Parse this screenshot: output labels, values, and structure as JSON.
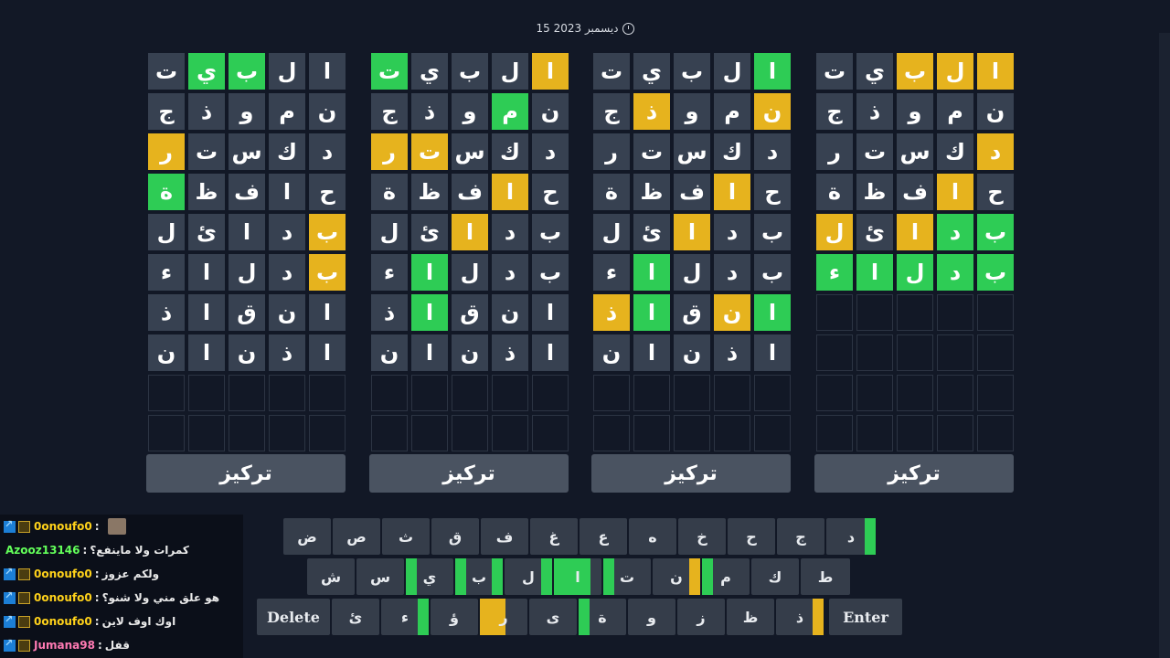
{
  "date_label": "15 ديسمبر 2023",
  "focus_label": "تركيز",
  "colors": {
    "green": "#2ecc55",
    "yellow": "#e6b31e",
    "tile": "#374151",
    "background": "#121826"
  },
  "boards": [
    {
      "rows": [
        [
          "ا",
          "ل",
          "ب",
          "ي",
          "ت"
        ],
        [
          "ن",
          "م",
          "و",
          "ذ",
          "ج"
        ],
        [
          "د",
          "ك",
          "س",
          "ت",
          "ر"
        ],
        [
          "ح",
          "ا",
          "ف",
          "ظ",
          "ة"
        ],
        [
          "ب",
          "د",
          "ا",
          "ئ",
          "ل"
        ],
        [
          "ب",
          "د",
          "ل",
          "ا",
          "ء"
        ],
        [
          "ا",
          "ن",
          "ق",
          "ا",
          "ذ"
        ],
        [
          "ا",
          "ذ",
          "ن",
          "ا",
          "ن"
        ],
        [
          "",
          "",
          "",
          "",
          ""
        ],
        [
          "",
          "",
          "",
          "",
          ""
        ]
      ],
      "states": [
        [
          "x",
          "x",
          "g",
          "g",
          "x"
        ],
        [
          "x",
          "x",
          "x",
          "x",
          "x"
        ],
        [
          "x",
          "x",
          "x",
          "x",
          "y"
        ],
        [
          "x",
          "x",
          "x",
          "x",
          "g"
        ],
        [
          "y",
          "x",
          "x",
          "x",
          "x"
        ],
        [
          "y",
          "x",
          "x",
          "x",
          "x"
        ],
        [
          "x",
          "x",
          "x",
          "x",
          "x"
        ],
        [
          "x",
          "x",
          "x",
          "x",
          "x"
        ],
        [
          "e",
          "e",
          "e",
          "e",
          "e"
        ],
        [
          "e",
          "e",
          "e",
          "e",
          "e"
        ]
      ]
    },
    {
      "rows": [
        [
          "ا",
          "ل",
          "ب",
          "ي",
          "ت"
        ],
        [
          "ن",
          "م",
          "و",
          "ذ",
          "ج"
        ],
        [
          "د",
          "ك",
          "س",
          "ت",
          "ر"
        ],
        [
          "ح",
          "ا",
          "ف",
          "ظ",
          "ة"
        ],
        [
          "ب",
          "د",
          "ا",
          "ئ",
          "ل"
        ],
        [
          "ب",
          "د",
          "ل",
          "ا",
          "ء"
        ],
        [
          "ا",
          "ن",
          "ق",
          "ا",
          "ذ"
        ],
        [
          "ا",
          "ذ",
          "ن",
          "ا",
          "ن"
        ],
        [
          "",
          "",
          "",
          "",
          ""
        ],
        [
          "",
          "",
          "",
          "",
          ""
        ]
      ],
      "states": [
        [
          "y",
          "x",
          "x",
          "x",
          "g"
        ],
        [
          "x",
          "g",
          "x",
          "x",
          "x"
        ],
        [
          "x",
          "x",
          "x",
          "y",
          "y"
        ],
        [
          "x",
          "y",
          "x",
          "x",
          "x"
        ],
        [
          "x",
          "x",
          "y",
          "x",
          "x"
        ],
        [
          "x",
          "x",
          "x",
          "g",
          "x"
        ],
        [
          "x",
          "x",
          "x",
          "g",
          "x"
        ],
        [
          "x",
          "x",
          "x",
          "x",
          "x"
        ],
        [
          "e",
          "e",
          "e",
          "e",
          "e"
        ],
        [
          "e",
          "e",
          "e",
          "e",
          "e"
        ]
      ]
    },
    {
      "rows": [
        [
          "ا",
          "ل",
          "ب",
          "ي",
          "ت"
        ],
        [
          "ن",
          "م",
          "و",
          "ذ",
          "ج"
        ],
        [
          "د",
          "ك",
          "س",
          "ت",
          "ر"
        ],
        [
          "ح",
          "ا",
          "ف",
          "ظ",
          "ة"
        ],
        [
          "ب",
          "د",
          "ا",
          "ئ",
          "ل"
        ],
        [
          "ب",
          "د",
          "ل",
          "ا",
          "ء"
        ],
        [
          "ا",
          "ن",
          "ق",
          "ا",
          "ذ"
        ],
        [
          "ا",
          "ذ",
          "ن",
          "ا",
          "ن"
        ],
        [
          "",
          "",
          "",
          "",
          ""
        ],
        [
          "",
          "",
          "",
          "",
          ""
        ]
      ],
      "states": [
        [
          "g",
          "x",
          "x",
          "x",
          "x"
        ],
        [
          "y",
          "x",
          "x",
          "y",
          "x"
        ],
        [
          "x",
          "x",
          "x",
          "x",
          "x"
        ],
        [
          "x",
          "y",
          "x",
          "x",
          "x"
        ],
        [
          "x",
          "x",
          "y",
          "x",
          "x"
        ],
        [
          "x",
          "x",
          "x",
          "g",
          "x"
        ],
        [
          "g",
          "y",
          "x",
          "g",
          "y"
        ],
        [
          "x",
          "x",
          "x",
          "x",
          "x"
        ],
        [
          "e",
          "e",
          "e",
          "e",
          "e"
        ],
        [
          "e",
          "e",
          "e",
          "e",
          "e"
        ]
      ]
    },
    {
      "rows": [
        [
          "ا",
          "ل",
          "ب",
          "ي",
          "ت"
        ],
        [
          "ن",
          "م",
          "و",
          "ذ",
          "ج"
        ],
        [
          "د",
          "ك",
          "س",
          "ت",
          "ر"
        ],
        [
          "ح",
          "ا",
          "ف",
          "ظ",
          "ة"
        ],
        [
          "ب",
          "د",
          "ا",
          "ئ",
          "ل"
        ],
        [
          "ب",
          "د",
          "ل",
          "ا",
          "ء"
        ],
        [
          "",
          "",
          "",
          "",
          ""
        ],
        [
          "",
          "",
          "",
          "",
          ""
        ],
        [
          "",
          "",
          "",
          "",
          ""
        ],
        [
          "",
          "",
          "",
          "",
          ""
        ]
      ],
      "states": [
        [
          "y",
          "y",
          "y",
          "x",
          "x"
        ],
        [
          "x",
          "x",
          "x",
          "x",
          "x"
        ],
        [
          "y",
          "x",
          "x",
          "x",
          "x"
        ],
        [
          "x",
          "y",
          "x",
          "x",
          "x"
        ],
        [
          "g",
          "g",
          "y",
          "x",
          "y"
        ],
        [
          "g",
          "g",
          "g",
          "g",
          "g"
        ],
        [
          "e",
          "e",
          "e",
          "e",
          "e"
        ],
        [
          "e",
          "e",
          "e",
          "e",
          "e"
        ],
        [
          "e",
          "e",
          "e",
          "e",
          "e"
        ],
        [
          "e",
          "e",
          "e",
          "e",
          "e"
        ]
      ]
    }
  ],
  "keyboard": {
    "row1": [
      "ض",
      "ص",
      "ث",
      "ق",
      "ف",
      "غ",
      "ع",
      "ه",
      "خ",
      "ح",
      "ج",
      "د"
    ],
    "row2": [
      "ش",
      "س",
      "ي",
      "ب",
      "ل",
      "ا",
      "ت",
      "ن",
      "م",
      "ك",
      "ط"
    ],
    "row3": [
      "Delete",
      "ئ",
      "ء",
      "ؤ",
      "ر",
      "ى",
      "ة",
      "و",
      "ز",
      "ظ",
      "ذ",
      "Enter"
    ]
  },
  "chat": [
    {
      "user": "0onoufo0",
      "msg": "",
      "has_avatar": true,
      "style": "gold",
      "badges": true
    },
    {
      "user": "Azooz13146",
      "msg": "كمرات ولا ماينفع؟",
      "has_avatar": false,
      "style": "green",
      "badges": false
    },
    {
      "user": "0onoufo0",
      "msg": "ولكم عزوز",
      "has_avatar": false,
      "style": "gold",
      "badges": true
    },
    {
      "user": "0onoufo0",
      "msg": "هو علق مني ولا شنو؟",
      "has_avatar": false,
      "style": "gold",
      "badges": true
    },
    {
      "user": "0onoufo0",
      "msg": "اوك اوف لاين",
      "has_avatar": false,
      "style": "gold",
      "badges": true
    },
    {
      "user": "Jumana98",
      "msg": "قفل",
      "has_avatar": false,
      "style": "pink",
      "badges": true
    }
  ]
}
